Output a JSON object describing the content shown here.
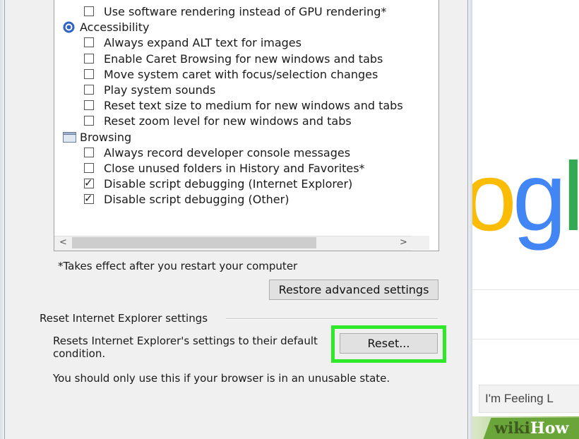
{
  "advanced": {
    "rows": [
      {
        "type": "checkbox",
        "label": "Use software rendering instead of GPU rendering*",
        "checked": false
      },
      {
        "type": "category",
        "label": "Accessibility",
        "icon": "accessibility-icon"
      },
      {
        "type": "checkbox",
        "label": "Always expand ALT text for images",
        "checked": false
      },
      {
        "type": "checkbox",
        "label": "Enable Caret Browsing for new windows and tabs",
        "checked": false
      },
      {
        "type": "checkbox",
        "label": "Move system caret with focus/selection changes",
        "checked": false
      },
      {
        "type": "checkbox",
        "label": "Play system sounds",
        "checked": false
      },
      {
        "type": "checkbox",
        "label": "Reset text size to medium for new windows and tabs",
        "checked": false
      },
      {
        "type": "checkbox",
        "label": "Reset zoom level for new windows and tabs",
        "checked": false
      },
      {
        "type": "category",
        "label": "Browsing",
        "icon": "browsing-icon"
      },
      {
        "type": "checkbox",
        "label": "Always record developer console messages",
        "checked": false
      },
      {
        "type": "checkbox",
        "label": "Close unused folders in History and Favorites*",
        "checked": false
      },
      {
        "type": "checkbox",
        "label": "Disable script debugging (Internet Explorer)",
        "checked": true
      },
      {
        "type": "checkbox",
        "label": "Disable script debugging (Other)",
        "checked": true
      }
    ],
    "restart_note": "*Takes effect after you restart your computer",
    "restore_button": "Restore advanced settings"
  },
  "reset": {
    "group_label": "Reset Internet Explorer settings",
    "description_line1": "Resets Internet Explorer's settings to their default",
    "description_line2": "condition.",
    "button_label": "Reset...",
    "warning": "You should only use this if your browser is in an unusable state."
  },
  "background": {
    "logo_partial": "ogl",
    "feeling_lucky": "I'm Feeling L",
    "watermark_wiki": "wiki",
    "watermark_how": "How"
  },
  "colors": {
    "highlight": "#2ee82a",
    "google_blue": "#4285f4",
    "google_green": "#34a853",
    "google_red": "#ea4335",
    "google_yellow": "#fbbc05"
  }
}
